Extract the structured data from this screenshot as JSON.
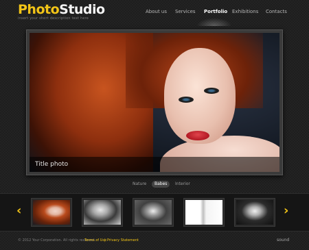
{
  "brand": {
    "logo_part1": "Photo",
    "logo_part2": "Studio",
    "tagline": "insert your short description text here",
    "accent_color": "#f2c417"
  },
  "nav": {
    "items": [
      {
        "label": "About us",
        "active": false
      },
      {
        "label": "Services",
        "active": false
      },
      {
        "label": "Portfolio",
        "active": true
      },
      {
        "label": "Exhibitions",
        "active": false
      },
      {
        "label": "Contacts",
        "active": false
      }
    ]
  },
  "main_photo": {
    "caption": "Title photo"
  },
  "categories": {
    "items": [
      {
        "label": "Nature",
        "active": false
      },
      {
        "label": "Babes",
        "active": true
      },
      {
        "label": "Interior",
        "active": false
      }
    ]
  },
  "thumbnails": {
    "prev_icon": "chevron-left-icon",
    "next_icon": "chevron-right-icon",
    "prev_glyph": "‹",
    "next_glyph": "›",
    "items": [
      {
        "selected": true,
        "tone": "color"
      },
      {
        "selected": false,
        "tone": "bw"
      },
      {
        "selected": false,
        "tone": "bw"
      },
      {
        "selected": false,
        "tone": "bw"
      },
      {
        "selected": false,
        "tone": "bw"
      }
    ]
  },
  "footer": {
    "copyright": "© 2012 Your Corporation.  All rights reserved.",
    "terms": "Terms of Use",
    "separator": "|",
    "privacy": "Privacy Statement",
    "sound": "sound"
  }
}
